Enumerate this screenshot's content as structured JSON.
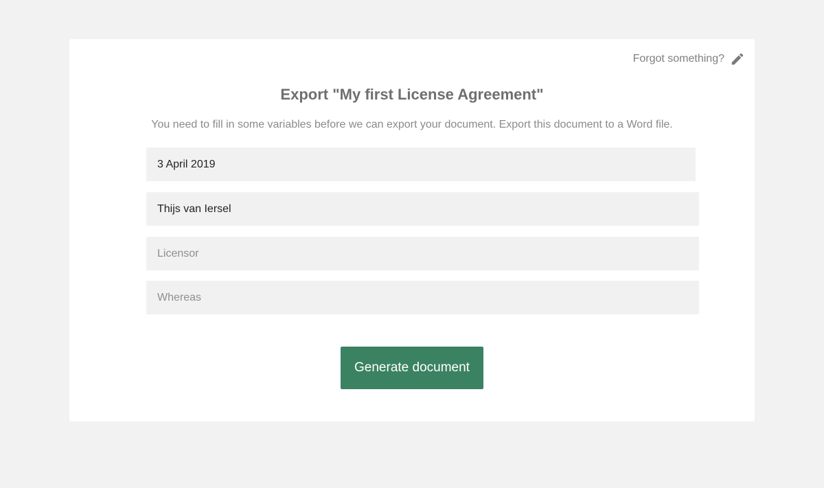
{
  "header": {
    "forgot_label": "Forgot something?",
    "forgot_icon": "pencil-icon"
  },
  "dialog": {
    "title": "Export \"My first License Agreement\"",
    "subtitle": "You need to fill in some variables before we can export your document. Export this document to a Word file."
  },
  "fields": [
    {
      "value": "3 April 2019",
      "placeholder": ""
    },
    {
      "value": "Thijs van Iersel",
      "placeholder": ""
    },
    {
      "value": "",
      "placeholder": "Licensor"
    },
    {
      "value": "",
      "placeholder": "Whereas"
    }
  ],
  "actions": {
    "generate_label": "Generate document"
  },
  "colors": {
    "accent": "#3a8262",
    "page_bg": "#f2f2f2",
    "field_bg": "#f1f1f1"
  }
}
